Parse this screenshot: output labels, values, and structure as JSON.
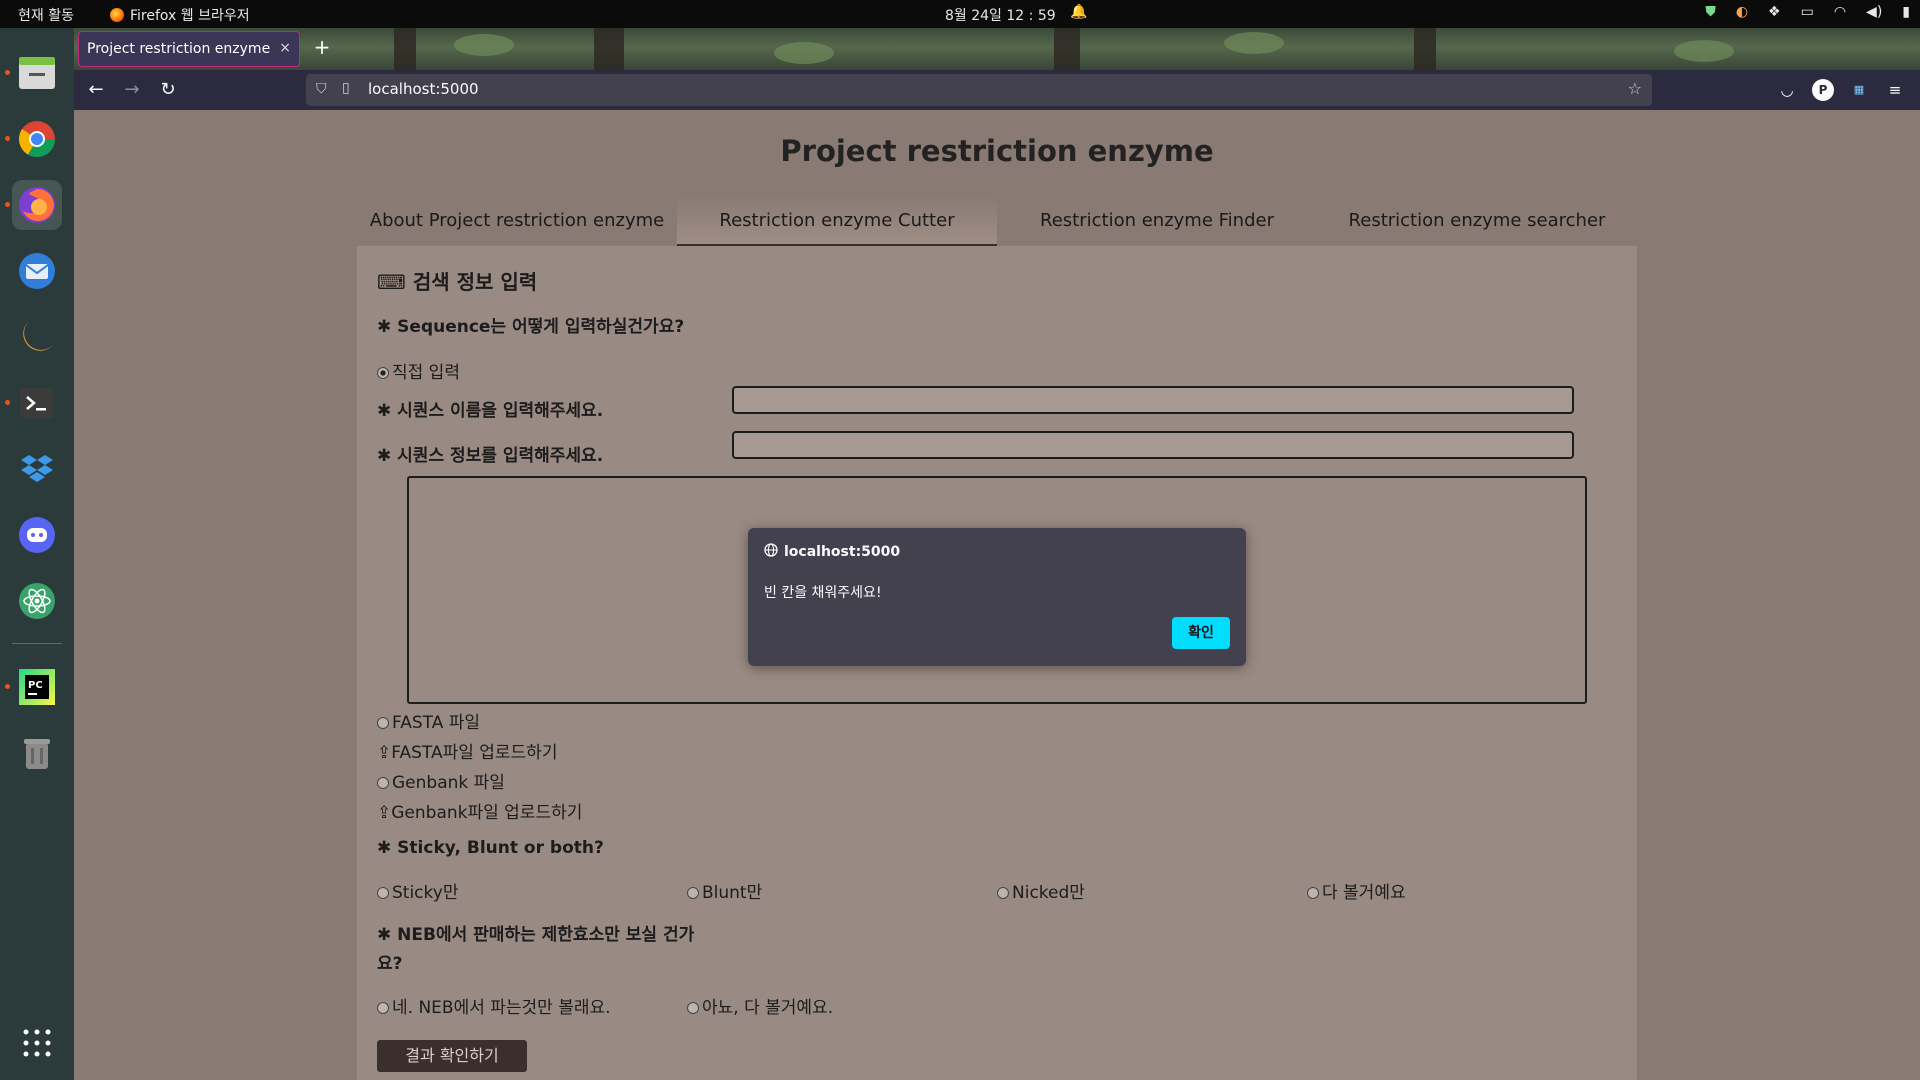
{
  "topbar": {
    "activities": "현재 활동",
    "app_name": "Firefox 웹 브라우저",
    "clock": "8월 24일 12 : 59"
  },
  "dock": {
    "items": [
      "files-icon",
      "chrome-icon",
      "firefox-icon",
      "thunderbird-icon",
      "orange-app-icon",
      "terminal-icon",
      "dropbox-icon",
      "discord-icon",
      "atom-icon",
      "pycharm-icon",
      "trash-icon",
      "app-grid-icon"
    ]
  },
  "browser": {
    "tab_title": "Project restriction enzyme",
    "tab_close": "×",
    "new_tab": "+",
    "url": "localhost:5000"
  },
  "page": {
    "title": "Project restriction enzyme",
    "tabs": [
      "About Project restriction enzyme",
      "Restriction enzyme Cutter",
      "Restriction enzyme Finder",
      "Restriction enzyme searcher"
    ],
    "active_tab": 1,
    "section_title": "검색 정보 입력",
    "q_sequence": "Sequence는 어떻게 입력하실건가요?",
    "opt_direct": "직접 입력",
    "q_seq_name": "시퀀스 이름을 입력해주세요.",
    "q_seq_info": "시퀀스 정보를 입력해주세요.",
    "opt_fasta": "FASTA 파일",
    "upload_fasta": "FASTA파일 업로드하기",
    "opt_genbank": "Genbank 파일",
    "upload_genbank": "Genbank파일 업로드하기",
    "q_end": "Sticky, Blunt or both?",
    "end_options": [
      "Sticky만",
      "Blunt만",
      "Nicked만",
      "다 볼거예요"
    ],
    "q_neb_line1": "NEB에서 판매하는 제한효소만 보실 건가",
    "q_neb_line2": "요?",
    "neb_options": [
      "네. NEB에서 파는것만 볼래요.",
      "아뇨, 다 볼거예요."
    ],
    "submit": "결과 확인하기"
  },
  "dialog": {
    "origin": "localhost:5000",
    "message": "빈 칸을 채워주세요!",
    "ok": "확인"
  }
}
